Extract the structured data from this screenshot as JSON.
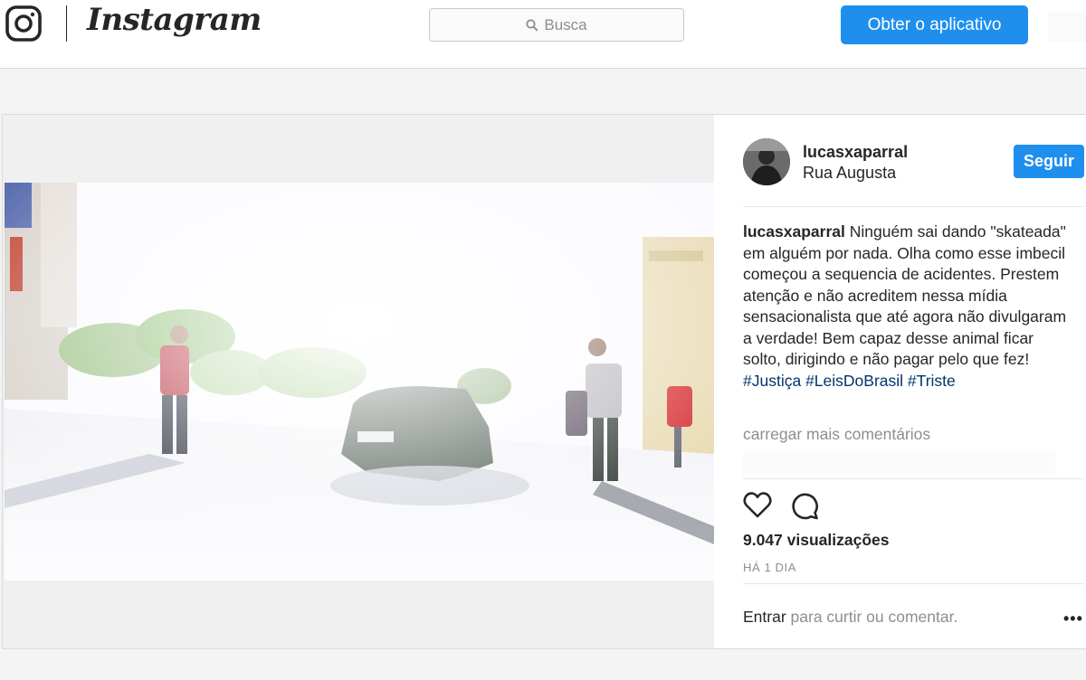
{
  "header": {
    "wordmark": "Instagram",
    "search_placeholder": "Busca",
    "get_app_label": "Obter o aplicativo"
  },
  "post": {
    "username": "lucasxaparral",
    "location": "Rua Augusta",
    "follow_label": "Seguir",
    "caption_text": "Ninguém sai dando \"skateada\" em alguém por nada. Olha como esse imbecil começou a sequencia de acidentes. Prestem atenção e não acreditem nessa mídia sensacionalista que até agora não divulgaram a verdade! Bem capaz desse animal ficar solto, dirigindo e não pagar pelo que fez!",
    "hashtags": [
      "#Justiça",
      "#LeisDoBrasil",
      "#Triste"
    ],
    "load_more": "carregar mais comentários",
    "views": "9.047 visualizações",
    "time": "HÁ 1 DIA",
    "login_link": "Entrar",
    "login_rest": "para curtir ou comentar.",
    "more_label": "•••"
  },
  "colors": {
    "accent": "#1f8fee",
    "hashtag": "#003569",
    "muted": "#8e8e8e"
  },
  "icons": {
    "logo": "instagram-camera-icon",
    "search": "search-icon",
    "like": "heart-icon",
    "comment": "comment-icon",
    "more": "more-options-icon"
  }
}
